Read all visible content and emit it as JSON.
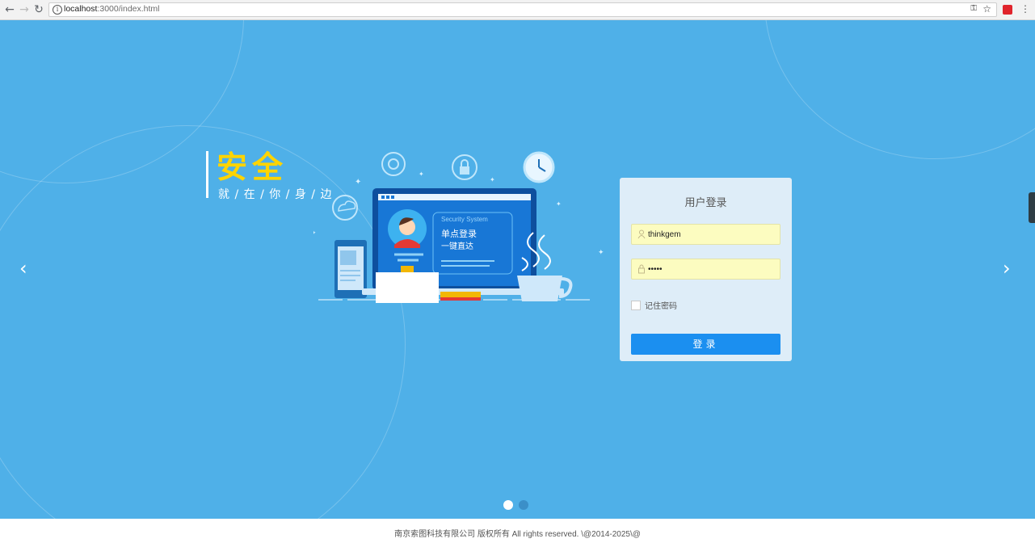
{
  "browser": {
    "url_host": "localhost",
    "url_path": ":3000/index.html",
    "back_icon": "arrow-left",
    "forward_icon": "arrow-right",
    "reload_icon": "reload"
  },
  "slogan": {
    "title": "安全",
    "subtitle": "就 / 在 / 你 / 身 / 边"
  },
  "illustration": {
    "screen_header": "Security System",
    "line1": "单点登录",
    "line2": "一键直达"
  },
  "login": {
    "title": "用户登录",
    "username_value": "thinkgem",
    "password_value": "•••••",
    "remember_label": "记住密码",
    "remember_checked": false,
    "submit_label": "登录"
  },
  "carousel": {
    "prev_glyph": "‹",
    "next_glyph": "›",
    "active_index": 0,
    "slides": 2
  },
  "footer": {
    "text": "南京索图科技有限公司 版权所有 All rights reserved. \\@2014-2025\\@"
  },
  "colors": {
    "hero_bg": "#4fb0e8",
    "accent": "#1b8ff0",
    "slogan": "#ffd400",
    "input_bg": "#fcfcc0"
  }
}
